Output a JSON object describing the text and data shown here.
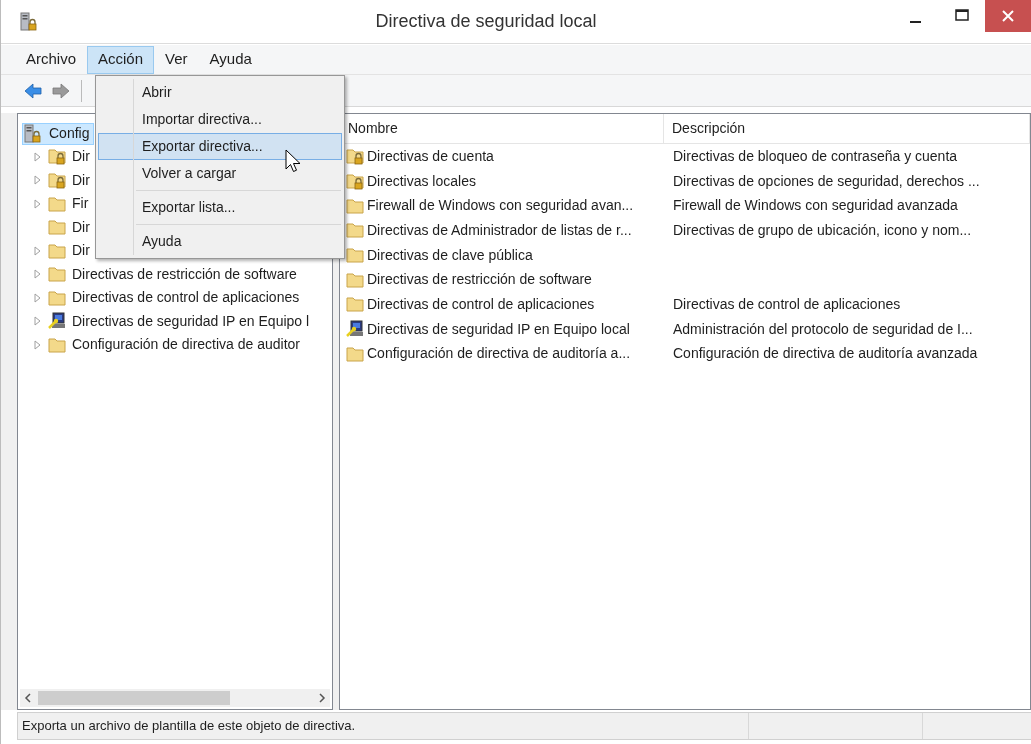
{
  "window": {
    "title": "Directiva de seguridad local"
  },
  "menu_bar": [
    {
      "label": "Archivo",
      "selected": false
    },
    {
      "label": "Acción",
      "selected": true
    },
    {
      "label": "Ver",
      "selected": false
    },
    {
      "label": "Ayuda",
      "selected": false
    }
  ],
  "toolbar": [
    {
      "kind": "back",
      "disabled": false
    },
    {
      "kind": "forward",
      "disabled": true
    }
  ],
  "tree": {
    "root": {
      "label": "Config",
      "selected": true
    },
    "items": [
      {
        "label": "Dir",
        "kind": "lock_folder",
        "expandable": true
      },
      {
        "label": "Dir",
        "kind": "lock_folder",
        "expandable": true
      },
      {
        "label": "Fir",
        "kind": "folder",
        "expandable": true
      },
      {
        "label": "Dir",
        "kind": "folder",
        "expandable": false
      },
      {
        "label": "Dir",
        "kind": "folder",
        "expandable": true
      },
      {
        "label": "Directivas de restricción de software",
        "kind": "folder",
        "expandable": true
      },
      {
        "label": "Directivas de control de aplicaciones",
        "kind": "folder",
        "expandable": true
      },
      {
        "label": "Directivas de seguridad IP en Equipo l",
        "kind": "ip_security",
        "expandable": true
      },
      {
        "label": "Configuración de directiva de auditor",
        "kind": "folder",
        "expandable": true
      }
    ]
  },
  "context_menu": {
    "items": [
      {
        "kind": "item",
        "label": "Abrir",
        "selected": false
      },
      {
        "kind": "item",
        "label": "Importar directiva...",
        "selected": false
      },
      {
        "kind": "item",
        "label": "Exportar directiva...",
        "selected": true
      },
      {
        "kind": "item",
        "label": "Volver a cargar",
        "selected": false
      },
      {
        "kind": "separator"
      },
      {
        "kind": "item",
        "label": "Exportar lista...",
        "selected": false
      },
      {
        "kind": "separator"
      },
      {
        "kind": "item",
        "label": "Ayuda",
        "selected": false
      }
    ]
  },
  "list": {
    "columns": [
      "Nombre",
      "Descripción"
    ],
    "rows": [
      {
        "kind": "lock_folder",
        "name": "Directivas de cuenta",
        "description": "Directivas de bloqueo de contraseña y cuenta"
      },
      {
        "kind": "lock_folder",
        "name": "Directivas locales",
        "description": "Directivas de opciones de seguridad, derechos ..."
      },
      {
        "kind": "folder",
        "name": "Firewall de Windows con seguridad avan...",
        "description": "Firewall de Windows con seguridad avanzada"
      },
      {
        "kind": "folder",
        "name": "Directivas de Administrador de listas de r...",
        "description": "Directivas de grupo de ubicación, icono y nom..."
      },
      {
        "kind": "folder",
        "name": "Directivas de clave pública"
      },
      {
        "kind": "folder",
        "name": "Directivas de restricción de software"
      },
      {
        "kind": "folder",
        "name": "Directivas de control de aplicaciones",
        "description": "Directivas de control de aplicaciones"
      },
      {
        "kind": "ip_security",
        "name": "Directivas de seguridad IP en Equipo local",
        "description": "Administración del protocolo de seguridad de I..."
      },
      {
        "kind": "folder",
        "name": "Configuración de directiva de auditoría a...",
        "description": "Configuración de directiva de auditoría avanzada"
      }
    ]
  },
  "status_bar": [
    "Exporta un archivo de plantilla de este objeto de directiva."
  ]
}
